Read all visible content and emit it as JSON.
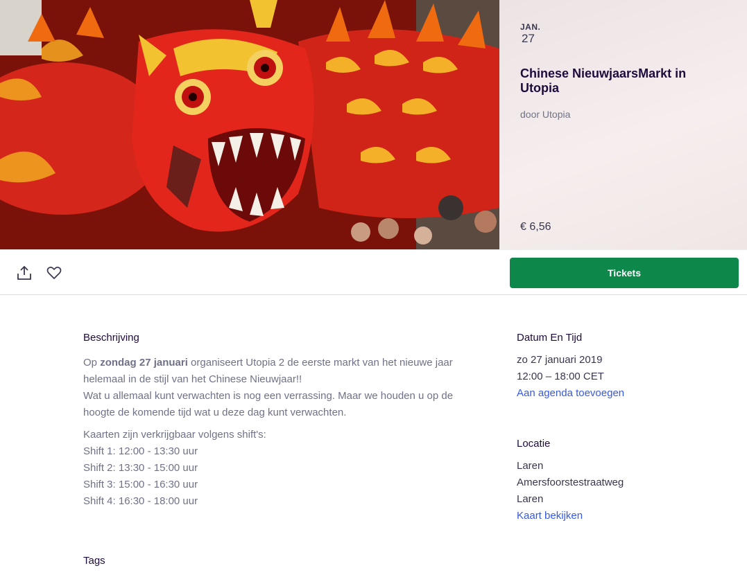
{
  "event": {
    "month": "JAN.",
    "day": "27",
    "title": "Chinese NieuwjaarsMarkt in Utopia",
    "organizer": "door Utopia",
    "price": "€ 6,56"
  },
  "actions": {
    "share_icon": "share-icon",
    "like_icon": "heart-icon",
    "tickets_label": "Tickets",
    "tickets_color": "#0d874a"
  },
  "description": {
    "heading": "Beschrijving",
    "intro_prefix": "Op ",
    "intro_bold": "zondag 27 januari",
    "intro_suffix": " organiseert Utopia 2 de eerste markt van het nieuwe jaar helemaal in de stijl van het Chinese Nieuwjaar!!",
    "intro_line2": "Wat u allemaal kunt verwachten is nog een verrassing. Maar we houden u op de hoogte de komende tijd wat u deze dag kunt verwachten.",
    "shifts_intro": "Kaarten zijn verkrijgbaar volgens shift's:",
    "shifts": [
      "Shift 1: 12:00 - 13:30 uur",
      "Shift 2: 13:30 - 15:00 uur",
      "Shift 3: 15:00 - 16:30 uur",
      "Shift 4: 16:30 - 18:00 uur"
    ]
  },
  "datetime": {
    "heading": "Datum En Tijd",
    "date": "zo 27 januari 2019",
    "time": "12:00 – 18:00 CET",
    "add_to_calendar": "Aan agenda toevoegen"
  },
  "location": {
    "heading": "Locatie",
    "line1": "Laren",
    "line2": "Amersfoorstestraatweg",
    "line3": "Laren",
    "view_map": "Kaart bekijken"
  },
  "tags": {
    "heading": "Tags"
  },
  "colors": {
    "link": "#3659e3",
    "body_text": "#6f7287",
    "heading_text": "#1e0a3c"
  }
}
